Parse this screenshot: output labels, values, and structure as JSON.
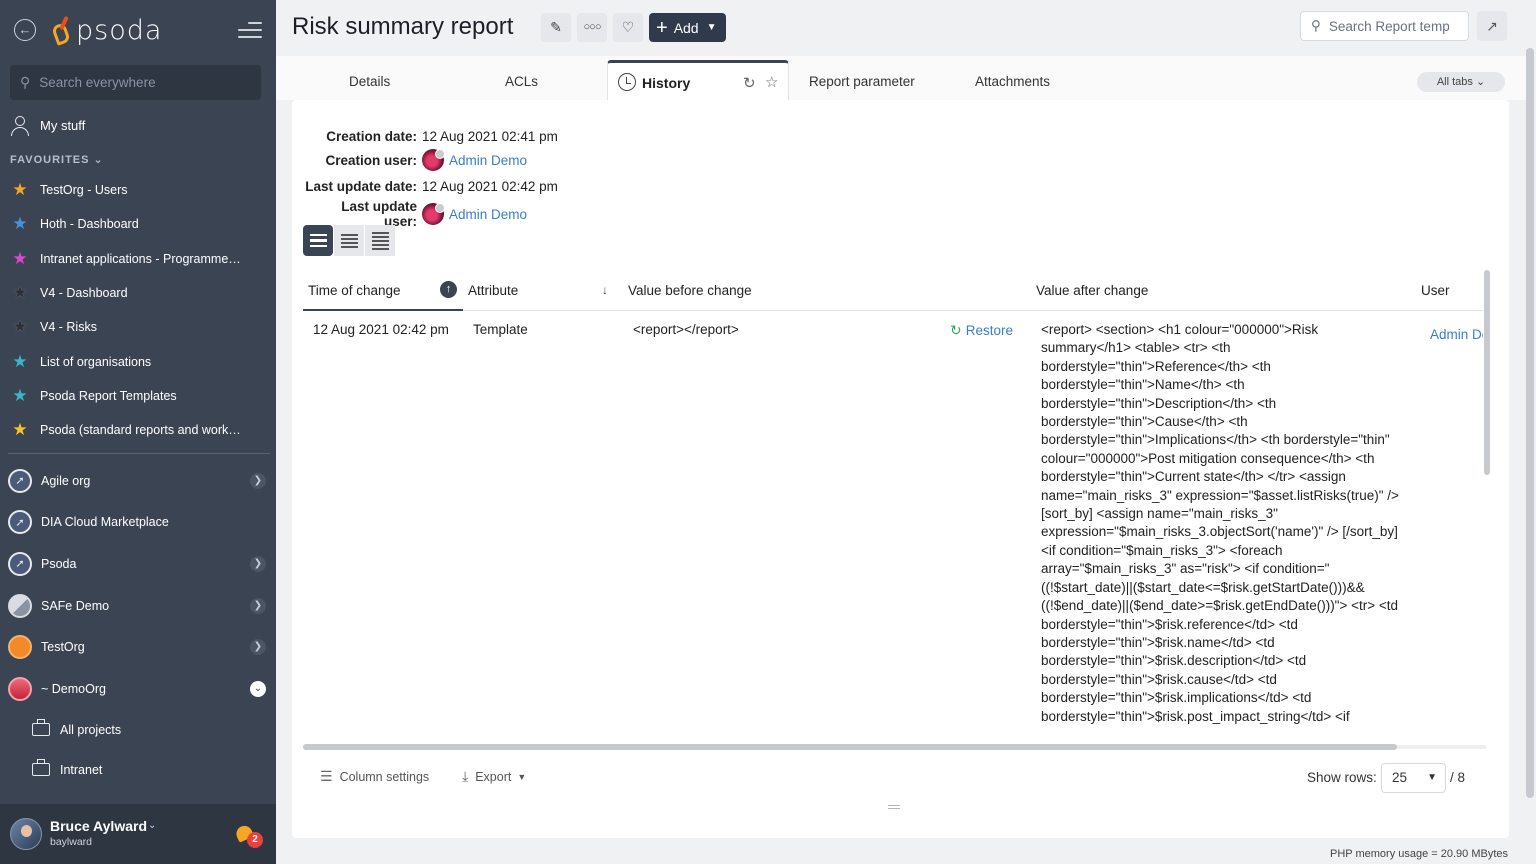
{
  "app": {
    "logo_text": "psoda",
    "search_placeholder": "Search everywhere",
    "my_stuff": "My stuff",
    "favourites_label": "FAVOURITES"
  },
  "favourites": [
    {
      "label": "TestOrg - Users",
      "color": "#f5a623"
    },
    {
      "label": "Hoth - Dashboard",
      "color": "#4a90d9"
    },
    {
      "label": "Intranet applications - Programme…",
      "color": "#d94ad0"
    },
    {
      "label": "V4 - Dashboard",
      "color": "#2b2f36"
    },
    {
      "label": "V4 - Risks",
      "color": "#2b2f36"
    },
    {
      "label": "List of organisations",
      "color": "#3bb6c8"
    },
    {
      "label": "Psoda Report Templates",
      "color": "#3bb6c8"
    },
    {
      "label": "Psoda (standard reports and work…",
      "color": "#f5c623"
    }
  ],
  "orgs": [
    {
      "label": "Agile org",
      "icon": "compass-icon",
      "expandable": true
    },
    {
      "label": "DIA Cloud Marketplace",
      "icon": "compass-icon",
      "expandable": false
    },
    {
      "label": "Psoda",
      "icon": "compass-icon",
      "expandable": true
    },
    {
      "label": "SAFe Demo",
      "icon": "safe-icon",
      "expandable": true
    },
    {
      "label": "TestOrg",
      "icon": "orange-circle-icon",
      "expandable": true
    },
    {
      "label": "~ DemoOrg",
      "icon": "red-circle-icon",
      "expandable": true,
      "open": true
    }
  ],
  "sub_items": [
    {
      "label": "All projects"
    },
    {
      "label": "Intranet"
    }
  ],
  "user": {
    "name": "Bruce Aylward",
    "login": "baylward",
    "notifications": "2"
  },
  "header": {
    "title": "Risk summary report",
    "add_label": "Add",
    "search_placeholder": "Search Report temp"
  },
  "tabs": {
    "details": "Details",
    "acls": "ACLs",
    "history": "History",
    "report_parameter": "Report parameter",
    "attachments": "Attachments",
    "all_tabs": "All tabs"
  },
  "meta": {
    "creation_date_label": "Creation date:",
    "creation_date": "12 Aug 2021 02:41 pm",
    "creation_user_label": "Creation user:",
    "creation_user": "Admin Demo",
    "last_update_date_label": "Last update date:",
    "last_update_date": "12 Aug 2021 02:42 pm",
    "last_update_user_label": "Last update user:",
    "last_update_user": "Admin Demo"
  },
  "table": {
    "columns": [
      "Time of change",
      "Attribute",
      "Value before change",
      "Value after change",
      "User"
    ],
    "rows": [
      {
        "time": "12 Aug 2021 02:42 pm",
        "attribute": "Template",
        "before": "<report></report>",
        "restore": "Restore",
        "after": "<report> <section> <h1 colour=\"000000\">Risk summary</h1> <table> <tr> <th borderstyle=\"thin\">Reference</th> <th borderstyle=\"thin\">Name</th> <th borderstyle=\"thin\">Description</th> <th borderstyle=\"thin\">Cause</th> <th borderstyle=\"thin\">Implications</th> <th borderstyle=\"thin\" colour=\"000000\">Post mitigation consequence</th> <th borderstyle=\"thin\">Current state</th> </tr> <assign name=\"main_risks_3\" expression=\"$asset.listRisks(true)\" /> [sort_by] <assign name=\"main_risks_3\" expression=\"$main_risks_3.objectSort('name')\" /> [/sort_by] <if condition=\"$main_risks_3\"> <foreach array=\"$main_risks_3\" as=\"risk\"> <if condition=\" ((!$start_date)||($start_date<=$risk.getStartDate()))&& ((!$end_date)||($end_date>=$risk.getEndDate()))\"> <tr> <td borderstyle=\"thin\">$risk.reference</td> <td borderstyle=\"thin\">$risk.name</td> <td borderstyle=\"thin\">$risk.description</td> <td borderstyle=\"thin\">$risk.cause</td> <td borderstyle=\"thin\">$risk.implications</td> <td borderstyle=\"thin\">$risk.post_impact_string</td> <if",
        "user": "Admin Demo"
      }
    ]
  },
  "footer": {
    "column_settings": "Column settings",
    "export": "Export",
    "show_rows_label": "Show rows:",
    "rows_value": "25",
    "pages": "/ 8",
    "memory": "PHP memory usage = 20.90 MBytes"
  }
}
